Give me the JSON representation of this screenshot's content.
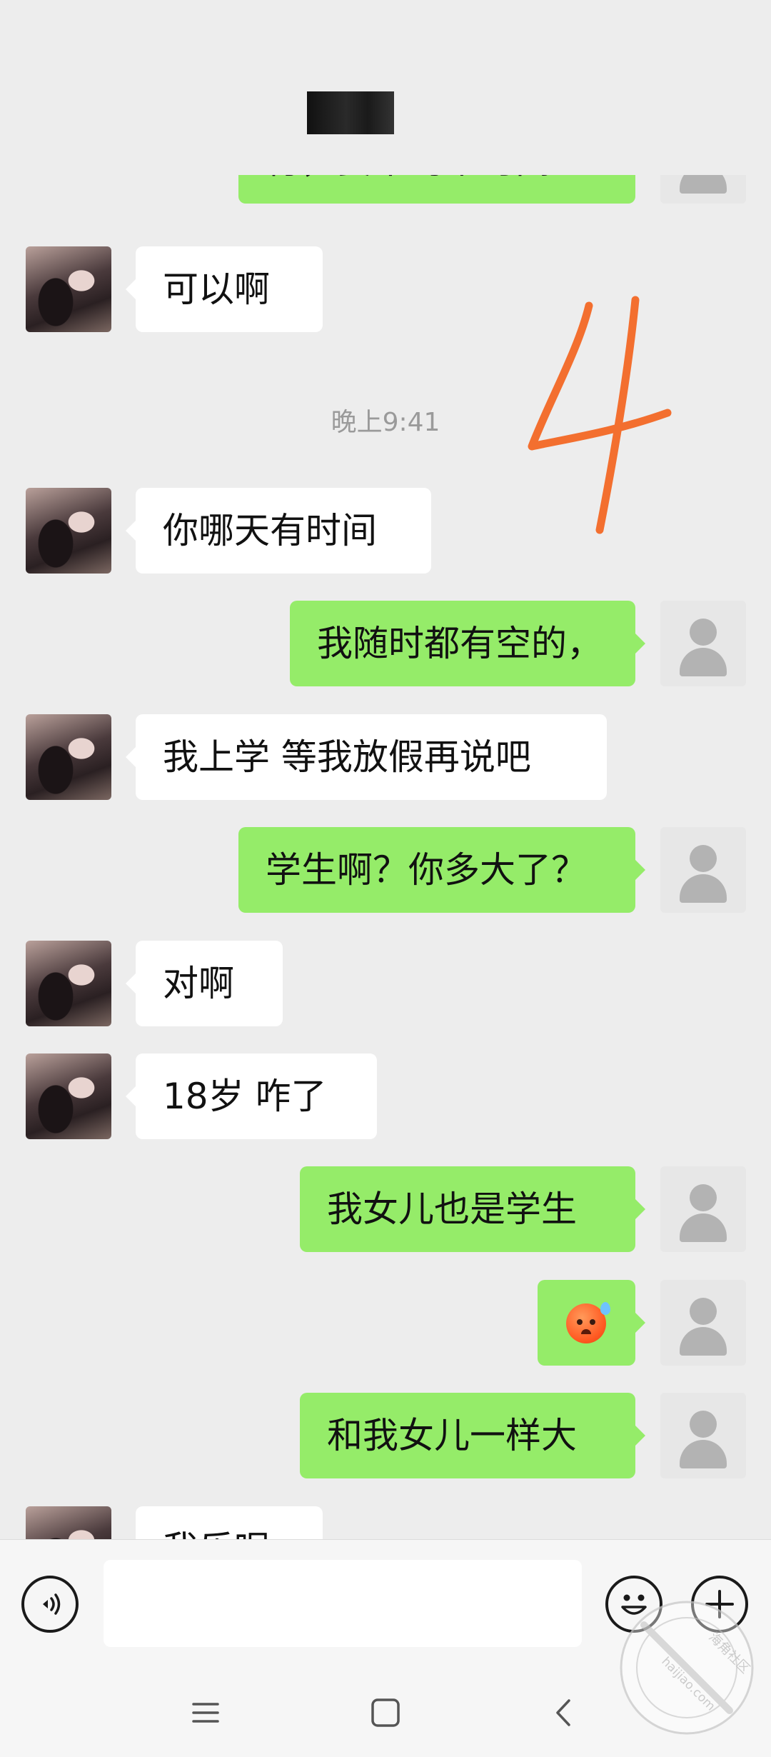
{
  "header": {
    "contact_name_redacted": true
  },
  "chat": {
    "timestamp": "晚上9:41",
    "messages_top": [
      {
        "side": "out",
        "text": "行，要不约个时间？"
      },
      {
        "side": "in",
        "text": "可以啊"
      }
    ],
    "messages": [
      {
        "side": "in",
        "text": "你哪天有时间"
      },
      {
        "side": "out",
        "text": "我随时都有空的，"
      },
      {
        "side": "in",
        "text": "我上学 等我放假再说吧"
      },
      {
        "side": "out",
        "text": "学生啊？你多大了？"
      },
      {
        "side": "in",
        "text": "对啊"
      },
      {
        "side": "in",
        "text": "18岁 咋了"
      },
      {
        "side": "out",
        "text": "我女儿也是学生"
      },
      {
        "side": "out",
        "emoji": "sweating-face-emoji"
      },
      {
        "side": "out",
        "text": "和我女儿一样大"
      },
      {
        "side": "in",
        "text": "我乐呢"
      }
    ]
  },
  "annotation": {
    "handwritten_mark": "4",
    "color": "#f36f2f"
  },
  "input_bar": {
    "voice_icon": "voice-icon",
    "input_placeholder": "",
    "emoji_icon": "emoji-icon",
    "plus_icon": "plus-icon"
  },
  "navbar": {
    "menu_icon": "menu-icon",
    "home_icon": "home-icon",
    "back_icon": "back-icon"
  },
  "watermark": {
    "site_name": "海角社区",
    "domain": "haijiao.com"
  },
  "colors": {
    "bubble_out": "#95ec69",
    "bubble_in": "#ffffff",
    "background": "#ededed"
  }
}
